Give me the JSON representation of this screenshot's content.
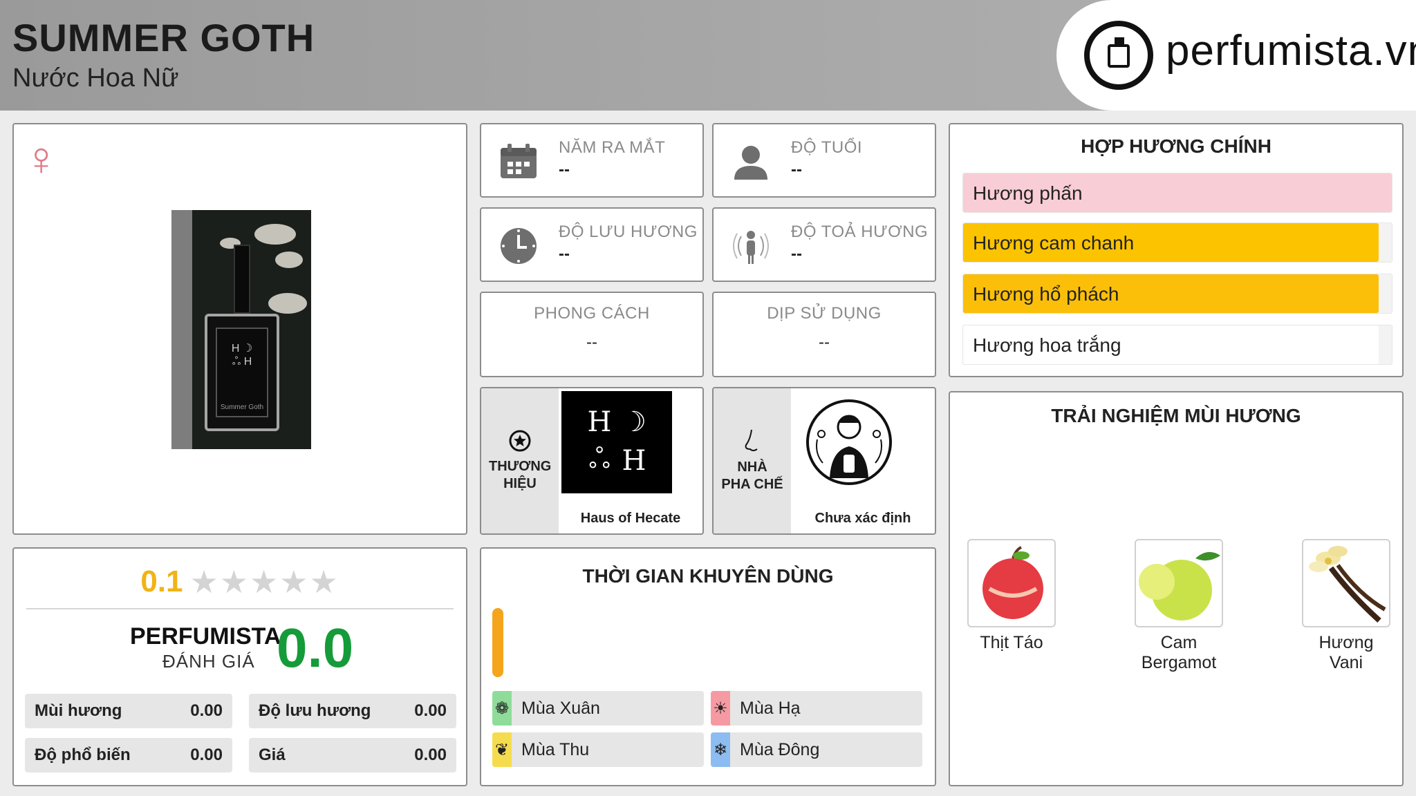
{
  "header": {
    "title": "SUMMER GOTH",
    "subtitle": "Nước Hoa Nữ",
    "logo_text": "perfumista.vn"
  },
  "info_cards": {
    "release_year": {
      "label": "NĂM RA MẮT",
      "value": "--",
      "icon": "calendar-icon"
    },
    "age": {
      "label": "ĐỘ TUỔI",
      "value": "--",
      "icon": "person-icon"
    },
    "longevity": {
      "label": "ĐỘ LƯU HƯƠNG",
      "value": "--",
      "icon": "clock-icon"
    },
    "sillage": {
      "label": "ĐỘ TOẢ HƯƠNG",
      "value": "--",
      "icon": "radiating-person-icon"
    },
    "style": {
      "label": "PHONG CÁCH",
      "value": "--"
    },
    "occasion": {
      "label": "DỊP SỬ DỤNG",
      "value": "--"
    }
  },
  "brand": {
    "label": "THƯƠNG HIỆU",
    "name": "Haus of Hecate",
    "logo_text": [
      "H",
      "☽",
      "ஃ",
      "H"
    ]
  },
  "perfumer": {
    "label": "NHÀ PHA CHẾ",
    "name": "Chưa xác định"
  },
  "accords": {
    "title": "HỢP HƯƠNG CHÍNH",
    "items": [
      {
        "name": "Hương phấn",
        "color": "#f9cdd6",
        "strength": 1.0
      },
      {
        "name": "Hương cam chanh",
        "color": "#fcc300",
        "strength": 0.97
      },
      {
        "name": "Hương hổ phách",
        "color": "#fbbf0a",
        "strength": 0.97
      },
      {
        "name": "Hương hoa trắng",
        "color": "#ffffff",
        "strength": 0.97
      }
    ]
  },
  "rating": {
    "user_score": "0.1",
    "stars_total": 5,
    "perfumista_label": "PERFUMISTA",
    "perfumista_sub": "ĐÁNH GIÁ",
    "perfumista_score": "0.0",
    "metrics": [
      {
        "label": "Mùi hương",
        "value": "0.00"
      },
      {
        "label": "Độ lưu hương",
        "value": "0.00"
      },
      {
        "label": "Độ phổ biến",
        "value": "0.00"
      },
      {
        "label": "Giá",
        "value": "0.00"
      }
    ]
  },
  "time": {
    "title": "THỜI GIAN KHUYÊN DÙNG",
    "bar_color": "#f4a51c",
    "seasons": [
      {
        "name": "Mùa Xuân",
        "color": "#8fdc9a",
        "icon": "flower-icon"
      },
      {
        "name": "Mùa Hạ",
        "color": "#f59aa3",
        "icon": "sun-icon"
      },
      {
        "name": "Mùa Thu",
        "color": "#f5dc4e",
        "icon": "leaf-icon"
      },
      {
        "name": "Mùa Đông",
        "color": "#8dbcf0",
        "icon": "snowflake-icon"
      }
    ]
  },
  "experience": {
    "title": "TRẢI NGHIỆM MÙI HƯƠNG",
    "notes": [
      {
        "name": "Thịt Táo",
        "icon": "apple-icon"
      },
      {
        "name": "Cam Bergamot",
        "icon": "bergamot-icon"
      },
      {
        "name": "Hương Vani",
        "icon": "vanilla-icon"
      }
    ]
  }
}
